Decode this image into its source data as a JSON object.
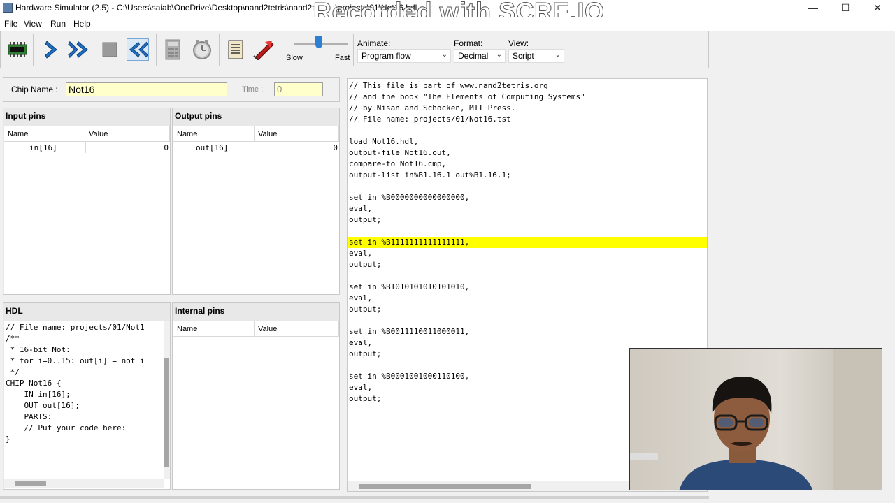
{
  "window": {
    "title": "Hardware Simulator (2.5) - C:\\Users\\saiab\\OneDrive\\Desktop\\nand2tetris\\nand2t",
    "title_tail": "\\projects\\01\\Not16.hdl",
    "watermark": "Recorded with SCRE.IO",
    "minimize": "—",
    "maximize": "☐",
    "close": "✕"
  },
  "menu": [
    "File",
    "View",
    "Run",
    "Help"
  ],
  "toolbar": {
    "speed_slow": "Slow",
    "speed_fast": "Fast",
    "speed_level": 0.45,
    "animate_label": "Animate:",
    "animate_value": "Program flow",
    "format_label": "Format:",
    "format_value": "Decimal",
    "view_label": "View:",
    "view_value": "Script"
  },
  "chip": {
    "name_label": "Chip Name :",
    "name_value": "Not16",
    "time_label": "Time :",
    "time_value": "0"
  },
  "input_pins": {
    "title": "Input pins",
    "col_name": "Name",
    "col_value": "Value",
    "rows": [
      {
        "name": "in[16]",
        "value": "0"
      }
    ]
  },
  "output_pins": {
    "title": "Output pins",
    "col_name": "Name",
    "col_value": "Value",
    "rows": [
      {
        "name": "out[16]",
        "value": "0"
      }
    ]
  },
  "hdl": {
    "title": "HDL",
    "lines": [
      "// File name: projects/01/Not1",
      "",
      "/**",
      " * 16-bit Not:",
      " * for i=0..15: out[i] = not i",
      " */",
      "",
      "CHIP Not16 {",
      "    IN in[16];",
      "    OUT out[16];",
      "",
      "    PARTS:",
      "    // Put your code here:",
      "}"
    ]
  },
  "internal_pins": {
    "title": "Internal pins",
    "col_name": "Name",
    "col_value": "Value"
  },
  "script": {
    "highlight_index": 14,
    "lines": [
      "// This file is part of www.nand2tetris.org",
      "// and the book \"The Elements of Computing Systems\"",
      "// by Nisan and Schocken, MIT Press.",
      "// File name: projects/01/Not16.tst",
      "",
      "load Not16.hdl,",
      "output-file Not16.out,",
      "compare-to Not16.cmp,",
      "output-list in%B1.16.1 out%B1.16.1;",
      "",
      "set in %B0000000000000000,",
      "eval,",
      "output;",
      "",
      "set in %B1111111111111111,",
      "eval,",
      "output;",
      "",
      "set in %B1010101010101010,",
      "eval,",
      "output;",
      "",
      "set in %B0011110011000011,",
      "eval,",
      "output;",
      "",
      "set in %B0001001000110100,",
      "eval,",
      "output;"
    ]
  },
  "colors": {
    "highlight": "#ffff00",
    "field_bg": "#ffffcc",
    "slider_accent": "#2d7fd3"
  }
}
